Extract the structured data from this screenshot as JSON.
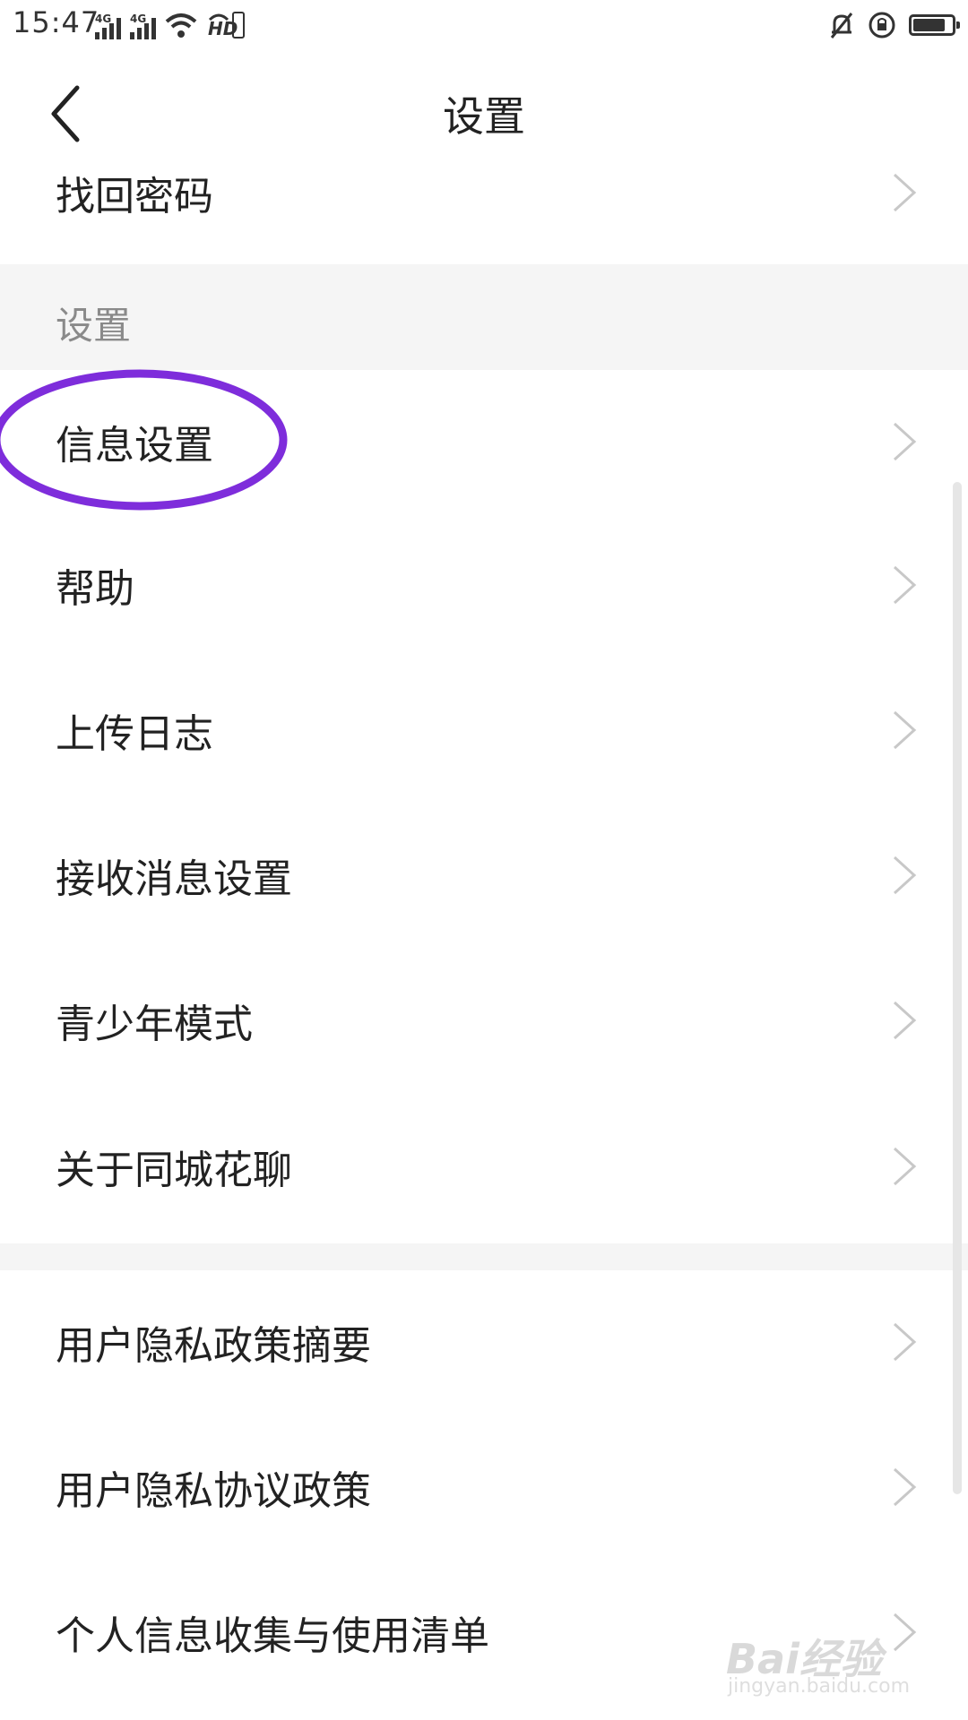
{
  "status_bar": {
    "time": "15:47",
    "network_1": "4G",
    "network_2": "4G",
    "hd_label": "HD",
    "icons": [
      "signal-icon",
      "signal-icon",
      "wifi-icon",
      "hd-icon",
      "mute-bell-icon",
      "rotation-lock-icon",
      "battery-icon"
    ],
    "battery_level": 0.85
  },
  "header": {
    "title": "设置",
    "back_icon": "chevron-left-icon"
  },
  "menu": {
    "find_password": "找回密码",
    "section_label": "设置",
    "items": [
      "信息设置",
      "帮助",
      "上传日志",
      "接收消息设置",
      "青少年模式",
      "关于同城花聊"
    ],
    "privacy_items": [
      "用户隐私政策摘要",
      "用户隐私协议政策",
      "个人信息收集与使用清单"
    ]
  },
  "annotation": {
    "highlight_color": "#7e2ddb"
  },
  "watermark": {
    "main": "Bai经验",
    "sub": "jingyan.baidu.com"
  }
}
